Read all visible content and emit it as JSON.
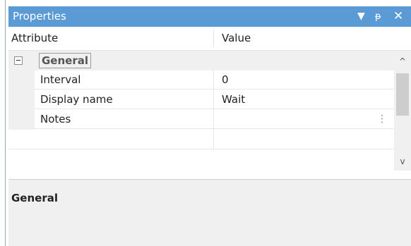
{
  "panel": {
    "title": "Properties",
    "controls": {
      "dropdown_icon": "▼",
      "pin_icon": "📌",
      "close_icon": "✕"
    }
  },
  "grid": {
    "headers": {
      "attribute": "Attribute",
      "value": "Value"
    },
    "category": {
      "label": "General",
      "expanded": true
    },
    "rows": [
      {
        "name": "Interval",
        "value": "0"
      },
      {
        "name": "Display name",
        "value": "Wait"
      },
      {
        "name": "Notes",
        "value": "",
        "ellipsis": "⋮"
      }
    ]
  },
  "scrollbar": {
    "up": "^",
    "down": "v"
  },
  "description": {
    "title": "General"
  },
  "colors": {
    "titlebar": "#5b9bd5",
    "gutter": "#f0f0f0"
  }
}
